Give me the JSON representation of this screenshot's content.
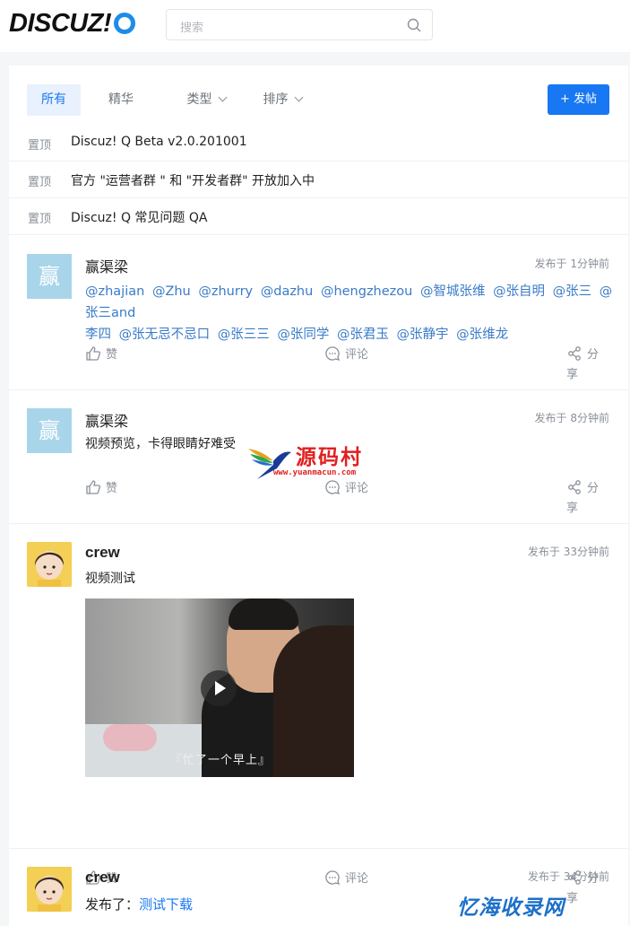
{
  "header": {
    "logo_text": "DISCUZ!",
    "search_placeholder": "搜索"
  },
  "toolbar": {
    "tabs": [
      {
        "label": "所有"
      },
      {
        "label": "精华"
      },
      {
        "label": "类型"
      },
      {
        "label": "排序"
      }
    ],
    "post_button": "+ 发帖"
  },
  "sticky": [
    {
      "tag": "置顶",
      "title": "Discuz! Q Beta v2.0.201001"
    },
    {
      "tag": "置顶",
      "title": "官方 \"运营者群 \" 和 \"开发者群\" 开放加入中"
    },
    {
      "tag": "置顶",
      "title": "Discuz! Q 常见问题 QA"
    }
  ],
  "threads": [
    {
      "avatar_text": "赢",
      "author": "赢渠梁",
      "time": "发布于 1分钟前",
      "mentions": [
        "@zhajian",
        "@Zhu",
        "@zhurry",
        "@dazhu",
        "@hengzhezou",
        "@智城张维",
        "@张自明",
        "@张三",
        "@张三and",
        "李四",
        "@张无忌不忌口",
        "@张三三",
        "@张同学",
        "@张君玉",
        "@张静宇",
        "@张维龙"
      ],
      "like": "赞",
      "comment": "评论",
      "share": "分享"
    },
    {
      "avatar_text": "赢",
      "author": "赢渠梁",
      "time": "发布于 8分钟前",
      "content": "视频预览，卡得眼睛好难受",
      "like": "赞",
      "comment": "评论",
      "share": "分享"
    },
    {
      "author": "crew",
      "time": "发布于 33分钟前",
      "content": "视频测试",
      "video_subtitle": "『忙了一个早上』",
      "like": "赞",
      "comment": "评论",
      "share": "分享"
    },
    {
      "author": "crew",
      "time": "发布于 34分钟前",
      "content_prefix": "发布了：",
      "content_link": "测试下载"
    }
  ],
  "watermarks": {
    "site_cn": "源码村",
    "site_url": "www.yuanmacun.com",
    "site2": "忆海收录网"
  },
  "colors": {
    "accent": "#1878f3",
    "mention": "#3a7bc8",
    "avatar_bg": "#a9d5ea"
  }
}
